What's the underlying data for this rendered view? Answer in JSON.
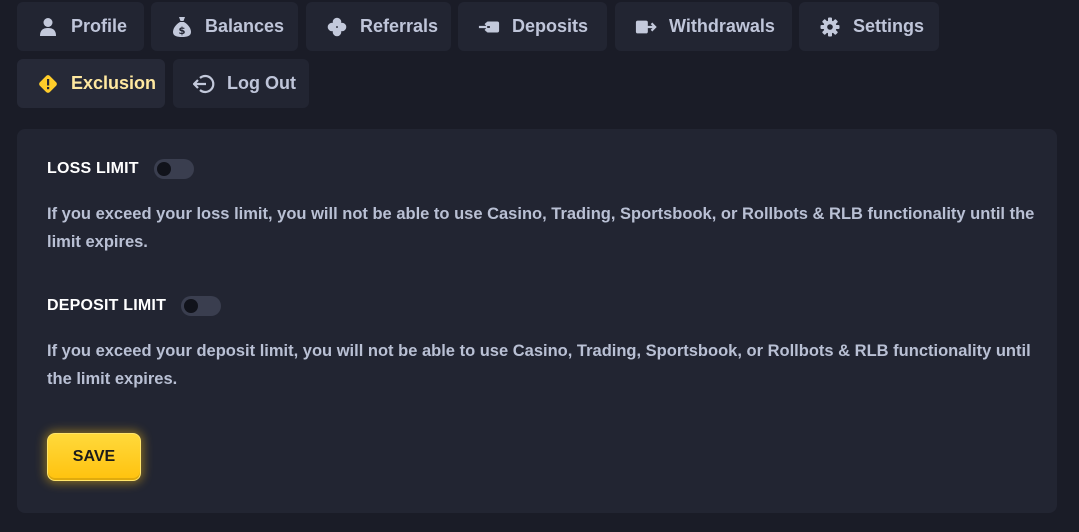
{
  "tabs": [
    {
      "label": "Profile",
      "icon": "user-icon"
    },
    {
      "label": "Balances",
      "icon": "money-bag-icon"
    },
    {
      "label": "Referrals",
      "icon": "clover-icon"
    },
    {
      "label": "Deposits",
      "icon": "deposit-icon"
    },
    {
      "label": "Withdrawals",
      "icon": "withdraw-icon"
    },
    {
      "label": "Settings",
      "icon": "gear-icon"
    },
    {
      "label": "Exclusion",
      "icon": "warning-diamond-icon",
      "active": true
    },
    {
      "label": "Log Out",
      "icon": "logout-icon"
    }
  ],
  "colors": {
    "accent": "#ffc20e",
    "page_bg": "#1a1c27",
    "panel_bg": "#222532"
  },
  "limits": {
    "loss": {
      "title": "LOSS LIMIT",
      "enabled": false,
      "description": "If you exceed your loss limit, you will not be able to use Casino, Trading, Sportsbook, or Rollbots & RLB functionality until the limit expires."
    },
    "deposit": {
      "title": "DEPOSIT LIMIT",
      "enabled": false,
      "description": "If you exceed your deposit limit, you will not be able to use Casino, Trading, Sportsbook, or Rollbots & RLB functionality until the limit expires."
    }
  },
  "save_label": "SAVE"
}
